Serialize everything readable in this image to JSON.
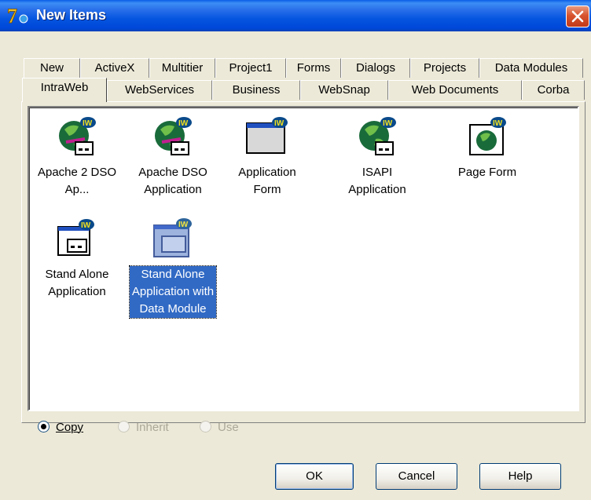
{
  "window": {
    "title": "New Items",
    "app_icon": "delphi-7-icon",
    "close_icon": "close-icon"
  },
  "tabs": {
    "row1": [
      "New",
      "ActiveX",
      "Multitier",
      "Project1",
      "Forms",
      "Dialogs",
      "Projects",
      "Data Modules"
    ],
    "row2": [
      "IntraWeb",
      "WebServices",
      "Business",
      "WebSnap",
      "Web Documents",
      "Corba"
    ],
    "active": "IntraWeb"
  },
  "items": [
    {
      "label": "Apache 2 DSO Ap...",
      "icon": "globe-app-icon",
      "selected": false
    },
    {
      "label": "Apache DSO Application",
      "icon": "globe-app-icon",
      "selected": false
    },
    {
      "label": "Application Form",
      "icon": "form-icon",
      "selected": false
    },
    {
      "label": "ISAPI Application",
      "icon": "globe-app-icon",
      "selected": false
    },
    {
      "label": "Page Form",
      "icon": "globe-page-icon",
      "selected": false
    },
    {
      "label": "Stand Alone Application",
      "icon": "window-app-icon",
      "selected": false
    },
    {
      "label": "Stand Alone Application with Data Module",
      "icon": "window-datamodule-icon",
      "selected": true
    }
  ],
  "options": [
    {
      "label": "Copy",
      "checked": true,
      "enabled": true
    },
    {
      "label": "Inherit",
      "checked": false,
      "enabled": false
    },
    {
      "label": "Use",
      "checked": false,
      "enabled": false
    }
  ],
  "buttons": {
    "ok": "OK",
    "cancel": "Cancel",
    "help": "Help"
  }
}
